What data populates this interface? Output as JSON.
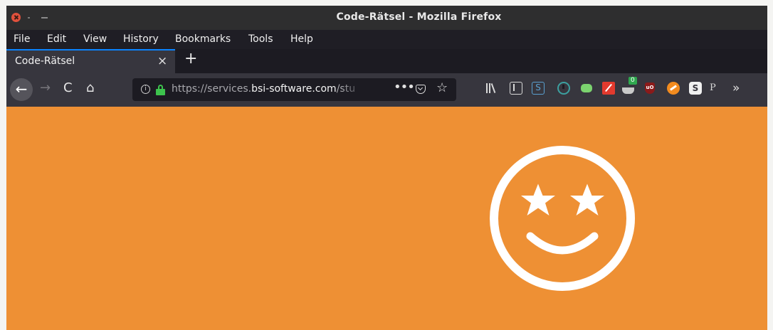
{
  "window": {
    "title": "Code-Rätsel - Mozilla Firefox"
  },
  "menu": [
    "File",
    "Edit",
    "View",
    "History",
    "Bookmarks",
    "Tools",
    "Help"
  ],
  "tab": {
    "title": "Code-Rätsel",
    "close_glyph": "×",
    "new_tab_glyph": "+"
  },
  "nav": {
    "back_glyph": "←",
    "forward_glyph": "→",
    "reload_glyph": "C",
    "home_glyph": "⌂"
  },
  "urlbar": {
    "info_glyph": "i",
    "url_prefix": "https://services.",
    "url_domain": "bsi-software.com",
    "url_suffix": "/stu",
    "page_actions_glyph": "•••",
    "bookmark_glyph": "☆"
  },
  "toolbar": {
    "s_ext_label": "S",
    "badge_count": "0",
    "ublock_label": "uO",
    "s_white_label": "S",
    "py_label": "P",
    "overflow_glyph": "»"
  },
  "content": {
    "background": "#ee9034",
    "icon": "star-eyes-smiley-icon"
  }
}
